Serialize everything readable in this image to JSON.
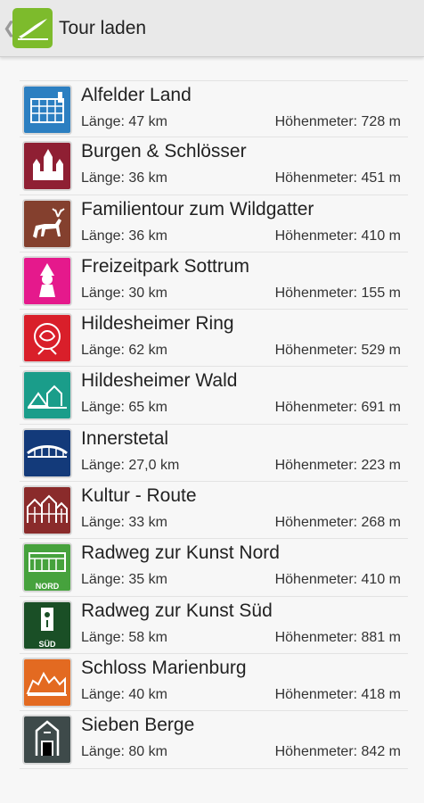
{
  "header": {
    "title": "Tour laden",
    "back_icon": "chevron-left-icon",
    "logo_icon": "app-logo-icon",
    "logo_color": "#7dbb2c"
  },
  "tours": [
    {
      "name": "Alfelder Land",
      "length": "Länge: 47 km",
      "elevation": "Höhenmeter: 728 m",
      "color": "#2c7fc1",
      "icon": "fagus-factory-icon"
    },
    {
      "name": "Burgen & Schlösser",
      "length": "Länge: 36 km",
      "elevation": "Höhenmeter: 451 m",
      "color": "#8f1f33",
      "icon": "castle-icon"
    },
    {
      "name": "Familientour zum Wildgatter",
      "length": "Länge: 36 km",
      "elevation": "Höhenmeter: 410 m",
      "color": "#84402e",
      "icon": "deer-icon"
    },
    {
      "name": "Freizeitpark Sottrum",
      "length": "Länge: 30 km",
      "elevation": "Höhenmeter: 155 m",
      "color": "#e5198c",
      "icon": "dwarf-icon"
    },
    {
      "name": "Hildesheimer Ring",
      "length": "Länge: 62 km",
      "elevation": "Höhenmeter: 529 m",
      "color": "#d91f2a",
      "icon": "rose-icon"
    },
    {
      "name": "Hildesheimer Wald",
      "length": "Länge: 65 km",
      "elevation": "Höhenmeter: 691 m",
      "color": "#1a9d8a",
      "icon": "forest-hut-icon"
    },
    {
      "name": "Innerstetal",
      "length": "Länge: 27,0 km",
      "elevation": "Höhenmeter: 223 m",
      "color": "#133a7a",
      "icon": "bridge-icon"
    },
    {
      "name": "Kultur - Route",
      "length": "Länge: 33 km",
      "elevation": "Höhenmeter: 268 m",
      "color": "#8a2b2b",
      "icon": "timber-houses-icon"
    },
    {
      "name": "Radweg zur Kunst Nord",
      "length": "Länge: 35 km",
      "elevation": "Höhenmeter: 410 m",
      "color": "#46a23d",
      "icon": "museum-nord-icon",
      "badge": "NORD"
    },
    {
      "name": "Radweg zur Kunst Süd",
      "length": "Länge: 58 km",
      "elevation": "Höhenmeter: 881 m",
      "color": "#1a4f26",
      "icon": "sculpture-sued-icon",
      "badge": "SÜD"
    },
    {
      "name": "Schloss Marienburg",
      "length": "Länge: 40 km",
      "elevation": "Höhenmeter: 418 m",
      "color": "#e36a21",
      "icon": "marienburg-icon"
    },
    {
      "name": "Sieben Berge",
      "length": "Länge: 80 km",
      "elevation": "Höhenmeter: 842 m",
      "color": "#3e4a4a",
      "icon": "tower-icon"
    }
  ]
}
